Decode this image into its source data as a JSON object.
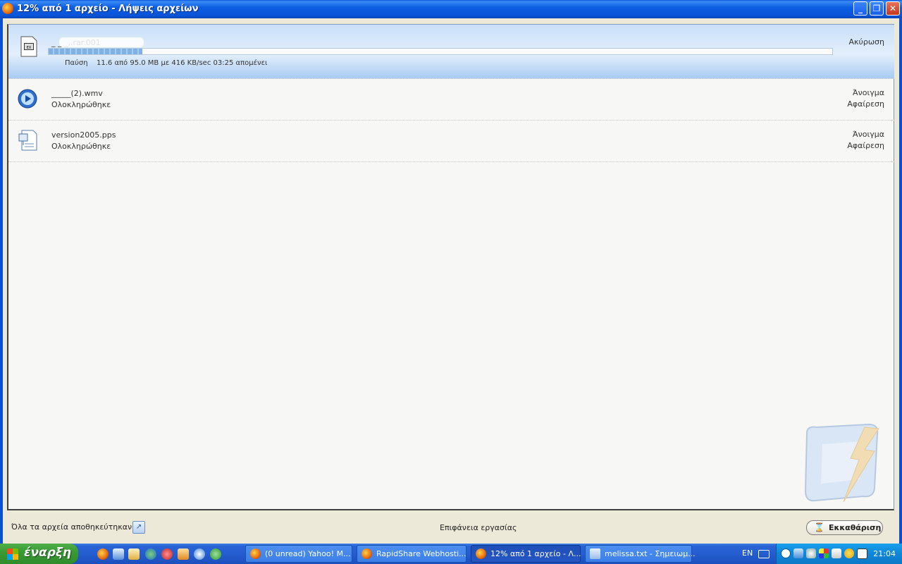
{
  "window": {
    "title": "12% από 1 αρχείο - Λήψεις αρχείων",
    "controls": {
      "minimize": "_",
      "restore": "❐",
      "close": "✕"
    }
  },
  "downloads": [
    {
      "name": "_ _ _,.rar.001",
      "status": "active",
      "progress_fraction": 0.12,
      "pause_label": "Παύση",
      "progress_text": "11.6 από 95.0 MB με 416 KB/sec 03:25 απομένει",
      "action": "Ακύρωση",
      "icon": "archive-file-icon"
    },
    {
      "name": "_____(2).wmv",
      "status": "Ολοκληρώθηκε",
      "actions": [
        "Άνοιγμα",
        "Αφαίρεση"
      ],
      "icon": "media-player-file-icon"
    },
    {
      "name": "version2005.pps",
      "status": "Ολοκληρώθηκε",
      "actions": [
        "Άνοιγμα",
        "Αφαίρεση"
      ],
      "icon": "presentation-file-icon"
    }
  ],
  "footer": {
    "saved_label": "Όλα τα αρχεία αποθηκεύτηκαν σε:",
    "folder": "Επιφάνεια εργασίας",
    "clear_button": "Εκκαθάριση"
  },
  "taskbar": {
    "start_label": "έναρξη",
    "tasks": [
      {
        "label": "(0 unread) Yahoo! M...",
        "icon": "firefox-icon"
      },
      {
        "label": "RapidShare Webhosti...",
        "icon": "firefox-icon"
      },
      {
        "label": "12% από 1 αρχείο - Λ...",
        "icon": "firefox-icon",
        "active": true
      },
      {
        "label": "melissa.txt - Σημειωμ...",
        "icon": "notepad-icon"
      }
    ],
    "language": "EN",
    "clock": "21:04"
  }
}
